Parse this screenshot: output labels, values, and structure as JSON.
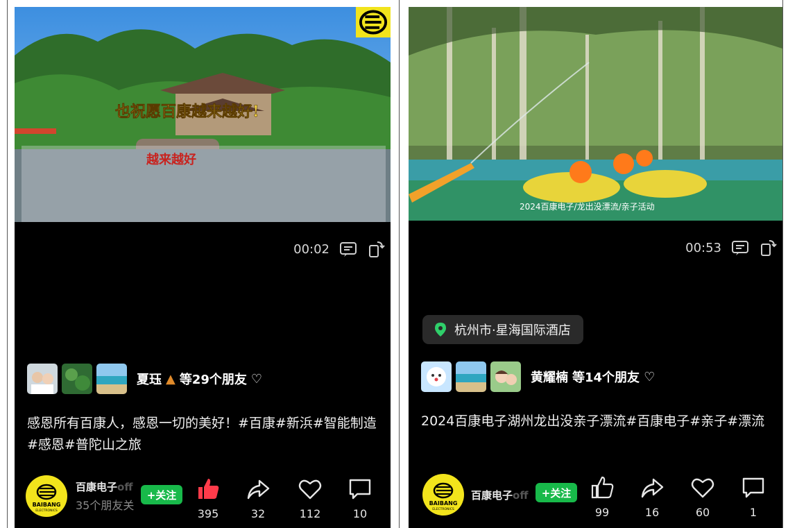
{
  "left_post": {
    "badge_icon": "baibang-logo",
    "hero_overlay_text": "也祝愿百康越来越好!",
    "sign_text": "越来越好",
    "time": "00:02",
    "friends": {
      "name": "夏珏",
      "suffix": "等29个朋友"
    },
    "caption": "感恩所有百康人，感恩一切的美好！#百康#新浜#智能制造#感恩#普陀山之旅",
    "account": {
      "name": "百康电子",
      "name_fade": "off",
      "subtitle": "35个朋友关",
      "logo_text": "BAIBANG",
      "logo_sub": "ELECTRONICS"
    },
    "follow_label": "+关注",
    "actions": {
      "like": "395",
      "share": "32",
      "favorite": "112",
      "comment": "10"
    }
  },
  "right_post": {
    "hero_overlay_text": "2024百康电子/龙出没漂流/亲子活动",
    "time": "00:53",
    "location": "杭州市·星海国际酒店",
    "friends": {
      "name": "黄耀楠",
      "suffix": "等14个朋友"
    },
    "caption": "2024百康电子湖州龙出没亲子漂流#百康电子#亲子#漂流",
    "account": {
      "name": "百康电子",
      "name_fade": "off",
      "logo_text": "BAIBANG",
      "logo_sub": "ELECTRONICS"
    },
    "follow_label": "+关注",
    "actions": {
      "like": "99",
      "share": "16",
      "favorite": "60",
      "comment": "1"
    }
  },
  "colors": {
    "accent_green": "#18b94a",
    "like_red": "#ff3b4a",
    "logo_yellow": "#f2e41c"
  }
}
